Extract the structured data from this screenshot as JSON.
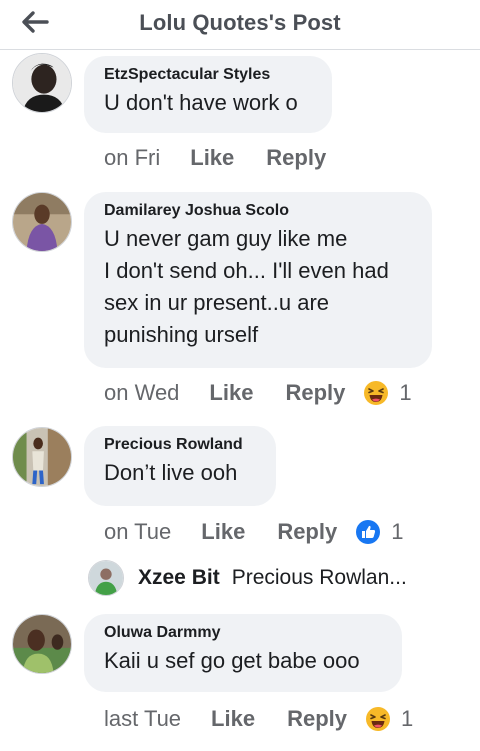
{
  "header": {
    "title": "Lolu Quotes's Post",
    "back_icon": "arrow-left-icon"
  },
  "comments": [
    {
      "author": "EtzSpectacular Styles",
      "lines": [
        "U don't have work o"
      ],
      "time": "on Fri",
      "like": "Like",
      "reply": "Reply"
    },
    {
      "author": "Damilarey Joshua Scolo",
      "lines": [
        "U never gam guy like me",
        "I don't send oh... I'll even had",
        "sex in ur present..u are",
        "punishing urself"
      ],
      "time": "on Wed",
      "like": "Like",
      "reply": "Reply",
      "reaction_icon": "laughing-emoji-icon",
      "reaction_count": "1"
    },
    {
      "author": "Precious Rowland",
      "lines": [
        "Don’t live ooh"
      ],
      "time": "on Tue",
      "like": "Like",
      "reply": "Reply",
      "reaction_icon": "thumbs-up-icon",
      "reaction_count": "1",
      "reply_preview": {
        "author": "Xzee Bit",
        "text": "Precious Rowlan..."
      }
    },
    {
      "author": "Oluwa Darmmy",
      "lines": [
        "Kaii u sef go get babe ooo"
      ],
      "time": "last Tue",
      "like": "Like",
      "reply": "Reply",
      "reaction_icon": "laughing-emoji-icon",
      "reaction_count": "1"
    }
  ],
  "colors": {
    "bubble": "#f0f2f5",
    "meta": "#65676b",
    "like_blue": "#1877f2",
    "emoji_yellow": "#f7b928"
  }
}
